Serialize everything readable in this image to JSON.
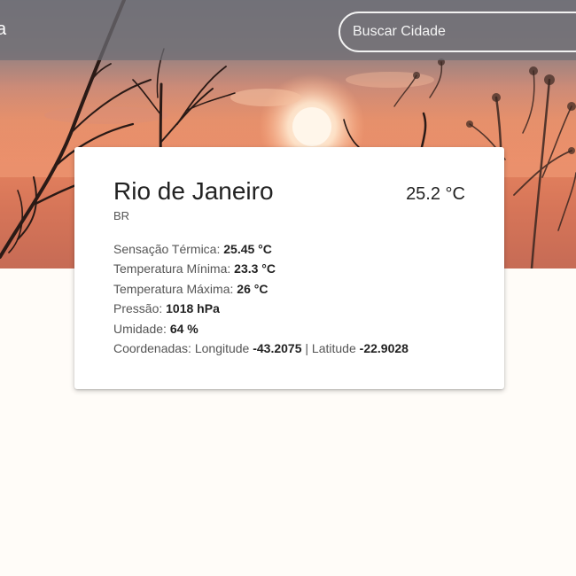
{
  "header": {
    "brand_partial": "a",
    "search": {
      "placeholder": "Buscar Cidade",
      "value": ""
    }
  },
  "weather": {
    "city": "Rio de Janeiro",
    "country": "BR",
    "temperature": "25.2 °C",
    "details": {
      "feels_like_label": "Sensação Térmica:",
      "feels_like_value": "25.45 °C",
      "min_label": "Temperatura Mínima:",
      "min_value": "23.3 °C",
      "max_label": "Temperatura Máxima:",
      "max_value": "26 °C",
      "pressure_label": "Pressão:",
      "pressure_value": "1018 hPa",
      "humidity_label": "Umidade:",
      "humidity_value": "64 %",
      "coords_label": "Coordenadas: Longitude",
      "longitude": "-43.2075",
      "coords_sep": "| Latitude",
      "latitude": "-22.9028"
    }
  },
  "colors": {
    "topbar": "#6e6e74",
    "sky_top": "#7c7a80",
    "sky_orange": "#e28b67",
    "card_bg": "#ffffff",
    "page_bg": "#fffcf8"
  }
}
